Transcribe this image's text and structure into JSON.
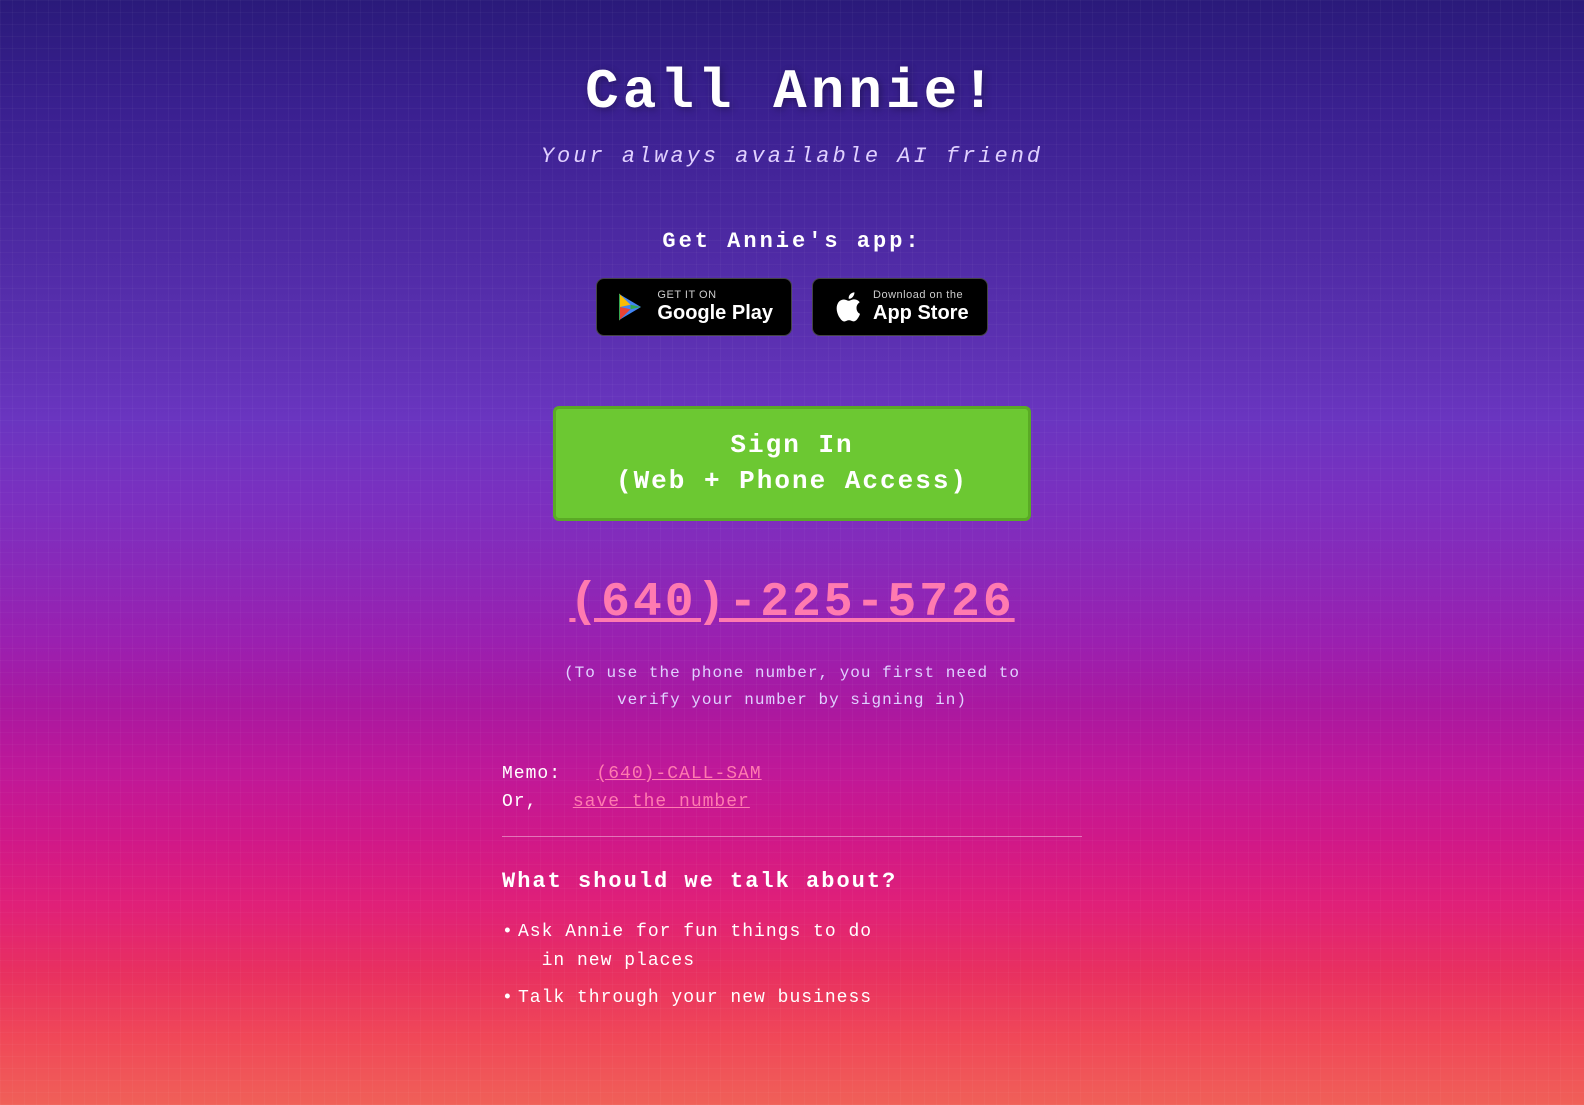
{
  "page": {
    "title": "Call Annie!",
    "subtitle": "Your always available AI friend",
    "get_app_label": "Get Annie's app:",
    "google_play": {
      "top_text": "GET IT ON",
      "bottom_text": "Google Play",
      "url": "#"
    },
    "app_store": {
      "top_text": "Download on the",
      "bottom_text": "App Store",
      "url": "#"
    },
    "sign_in_button": "Sign In\n(Web + Phone Access)",
    "sign_in_line1": "Sign In",
    "sign_in_line2": "(Web + Phone Access)",
    "phone_number": "(640)-225-5726",
    "phone_notice_line1": "(To use the phone number, you first need to",
    "phone_notice_line2": "verify your number by signing in)",
    "memo_label": "Memo:",
    "memo_link_text": "(640)-CALL-SAM",
    "or_label": "Or,",
    "save_number_text": "save the number",
    "talk_about_title": "What should we talk about?",
    "talk_about_items": [
      "Ask Annie for fun things to do\n  in new places",
      "Talk through your new business"
    ]
  }
}
